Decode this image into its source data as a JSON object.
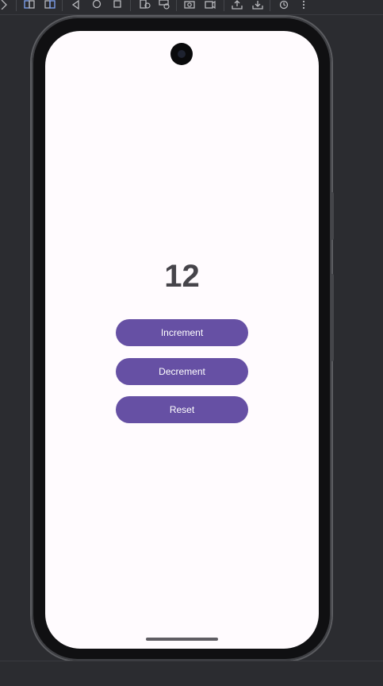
{
  "app": {
    "counter_value": "12"
  },
  "buttons": {
    "increment": "Increment",
    "decrement": "Decrement",
    "reset": "Reset"
  },
  "toolbar": {
    "icons": [
      "pointer-icon",
      "fold-icon",
      "unfold-icon",
      "back-icon",
      "home-icon",
      "overview-icon",
      "rotate-left-icon",
      "rotate-right-icon",
      "screenshot-icon",
      "record-icon",
      "upload-icon",
      "download-icon",
      "history-icon",
      "more-icon"
    ]
  },
  "colors": {
    "background": "#2b2c30",
    "screen": "#fffbfe",
    "primary": "#6650a4",
    "counter_text": "#46444a"
  }
}
